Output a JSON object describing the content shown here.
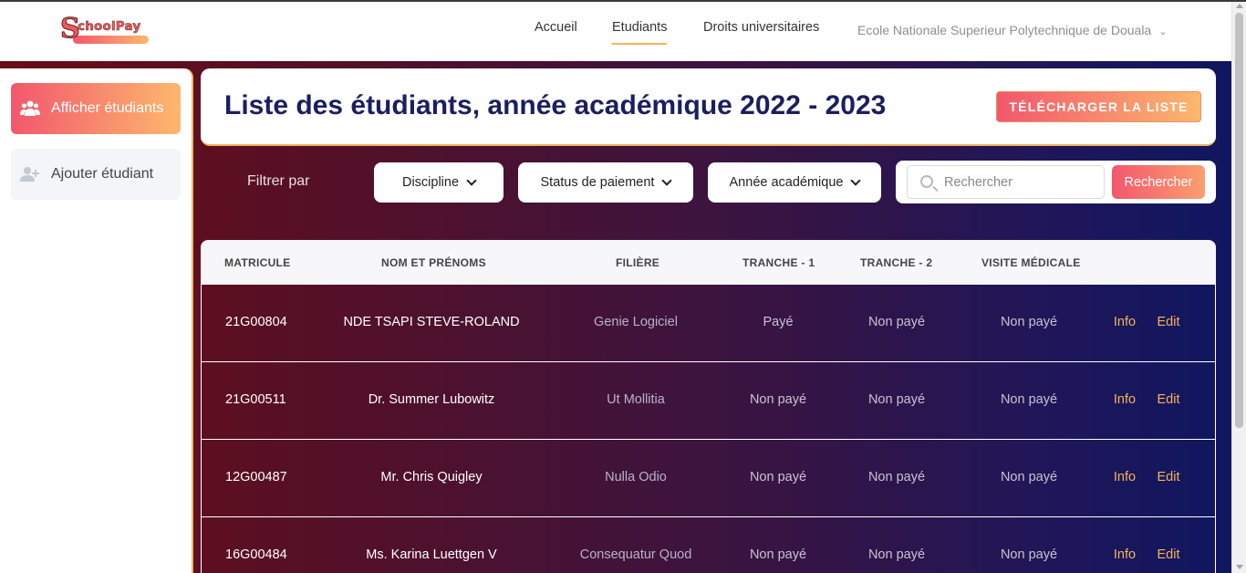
{
  "brand": {
    "logo_initial": "S",
    "logo_text": "choolPay"
  },
  "nav": {
    "items": [
      {
        "label": "Accueil"
      },
      {
        "label": "Etudiants"
      },
      {
        "label": "Droits universitaires"
      }
    ],
    "school": "Ecole Nationale Superieur Polytechnique de Douala"
  },
  "sidebar": {
    "items": [
      {
        "label": "Afficher étudiants",
        "icon": "users-icon"
      },
      {
        "label": "Ajouter étudiant",
        "icon": "user-plus-icon"
      }
    ]
  },
  "main": {
    "title": "Liste des étudiants, année académique 2022 - 2023",
    "download_label": "TÉLÉCHARGER LA LISTE"
  },
  "filters": {
    "label": "Filtrer par",
    "discipline": "Discipline",
    "payment_status": "Status de paiement",
    "academic_year": "Année académique",
    "search_placeholder": "Rechercher",
    "search_button": "Rechercher"
  },
  "table": {
    "headers": [
      "MATRICULE",
      "NOM ET PRÉNOMS",
      "FILIÈRE",
      "TRANCHE - 1",
      "TRANCHE - 2",
      "VISITE MÉDICALE"
    ],
    "action_info": "Info",
    "action_edit": "Edit",
    "rows": [
      {
        "matricule": "21G00804",
        "name": "NDE TSAPI STEVE-ROLAND",
        "filiere": "Genie Logiciel",
        "tranche1": "Payé",
        "tranche2": "Non payé",
        "visite": "Non payé"
      },
      {
        "matricule": "21G00511",
        "name": "Dr. Summer Lubowitz",
        "filiere": "Ut Mollitia",
        "tranche1": "Non payé",
        "tranche2": "Non payé",
        "visite": "Non payé"
      },
      {
        "matricule": "12G00487",
        "name": "Mr. Chris Quigley",
        "filiere": "Nulla Odio",
        "tranche1": "Non payé",
        "tranche2": "Non payé",
        "visite": "Non payé"
      },
      {
        "matricule": "16G00484",
        "name": "Ms. Karina Luettgen V",
        "filiere": "Consequatur Quod",
        "tranche1": "Non payé",
        "tranche2": "Non payé",
        "visite": "Non payé"
      }
    ]
  },
  "colors": {
    "accent_start": "#f3576d",
    "accent_end": "#fcb86d",
    "title": "#1b1f5e",
    "link": "#f4b45a"
  }
}
